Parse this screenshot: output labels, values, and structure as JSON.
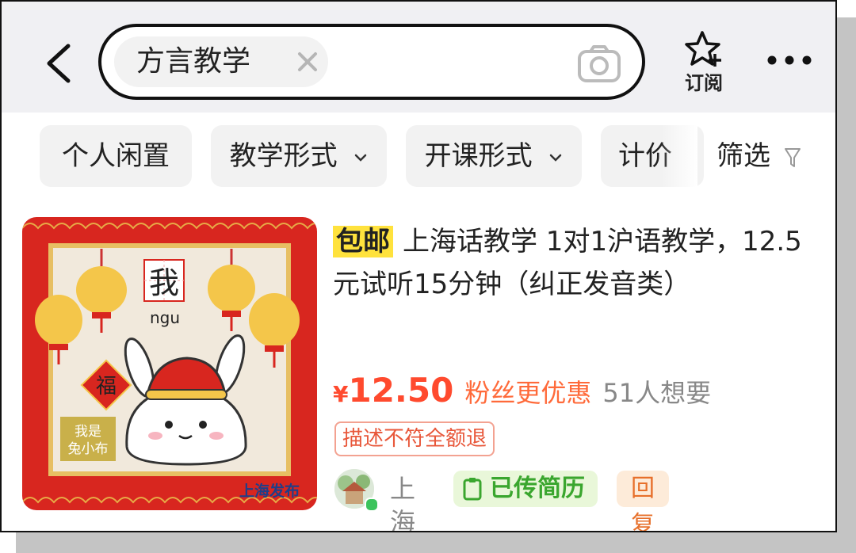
{
  "search": {
    "query": "方言教学",
    "subscribe_label": "订阅"
  },
  "filters": [
    {
      "label": "个人闲置",
      "has_caret": false
    },
    {
      "label": "教学形式",
      "has_caret": true
    },
    {
      "label": "开课形式",
      "has_caret": true
    },
    {
      "label": "计价",
      "has_caret": false
    }
  ],
  "screen_label": "筛选",
  "listing": {
    "free_shipping_tag": "包邮",
    "title": "上海话教学  1对1沪语教学，12.5元试听15分钟（纠正发音类）",
    "thumb": {
      "character": "我",
      "pinyin": "ngu",
      "fu": "福",
      "sign_line1": "我是",
      "sign_line2": "兔小布",
      "watermark": "上海发布"
    },
    "currency": "¥",
    "price": "12.50",
    "fans_discount": "粉丝更优惠",
    "wants": "51人想要",
    "refund_badge": "描述不符全额退",
    "seller_city": "上海",
    "resume_badge": "已传简历",
    "reply_badge": "回复超快"
  },
  "colors": {
    "price_red": "#ff4a2e",
    "tag_yellow": "#ffe23d",
    "green": "#3aa62e",
    "orange": "#e7702b"
  }
}
